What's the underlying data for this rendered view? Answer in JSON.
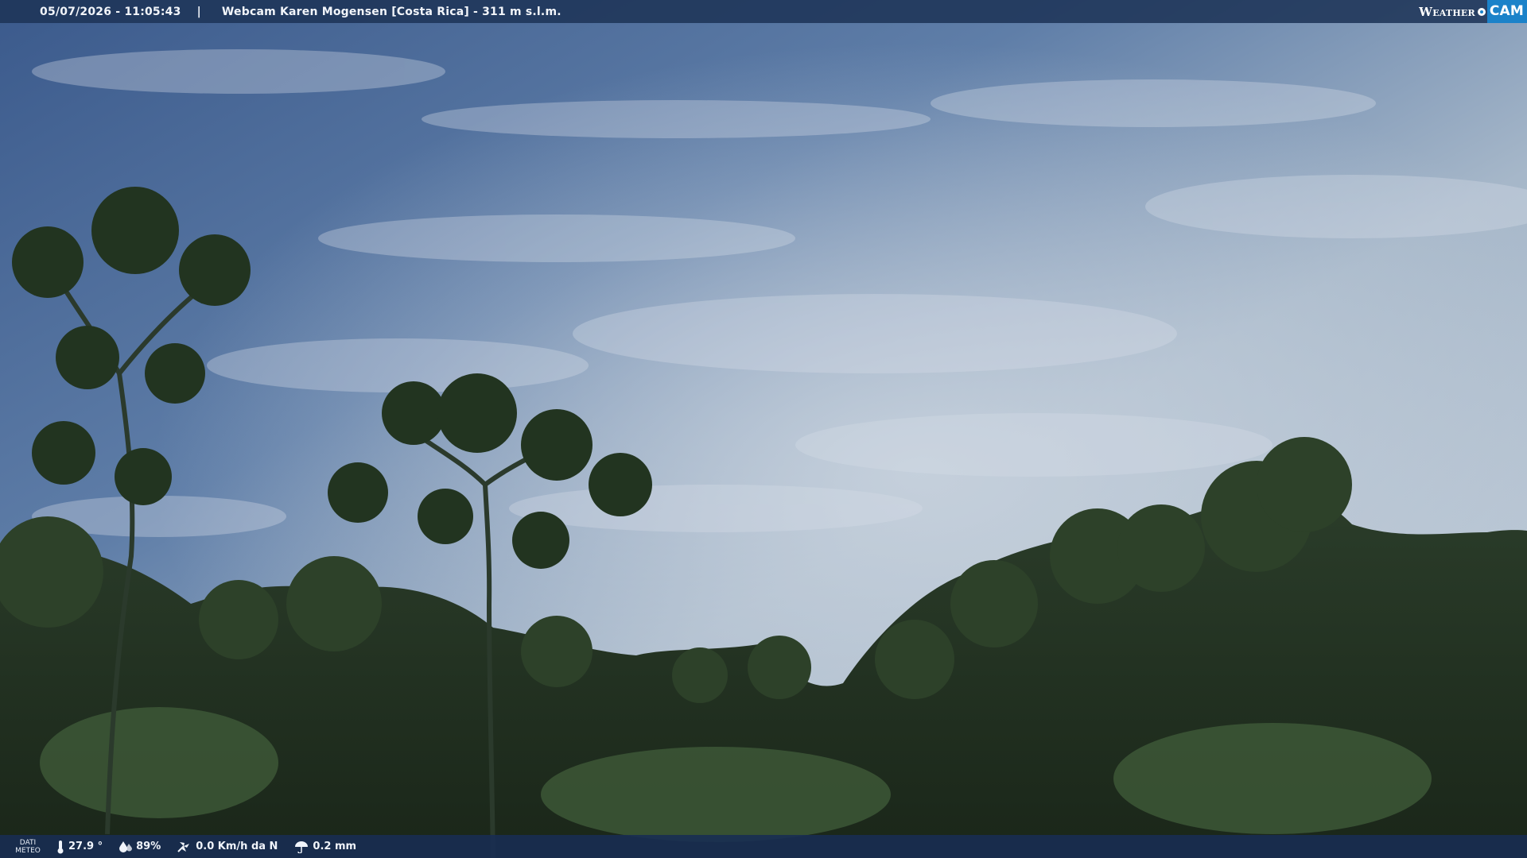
{
  "header": {
    "timestamp": "05/07/2026 - 11:05:43",
    "separator": "|",
    "title": "Webcam Karen Mogensen [Costa Rica]  - 311 m s.l.m.",
    "logo_word": "Weather",
    "logo_cam": "CAM"
  },
  "footer": {
    "meteo_line1": "DATI",
    "meteo_line2": "METEO",
    "temperature": "27.9 °",
    "humidity": "89%",
    "wind": "0.0 Km/h da N",
    "rain": "0.2 mm"
  },
  "colors": {
    "bar": "#1e3458",
    "logo_accent": "#1b82c9",
    "sky_top": "#3f5f91",
    "sky_light": "#b9c6d4",
    "foliage": "#22331f"
  },
  "icons": [
    "thermometer-icon",
    "humidity-icon",
    "wind-icon",
    "rain-icon"
  ]
}
